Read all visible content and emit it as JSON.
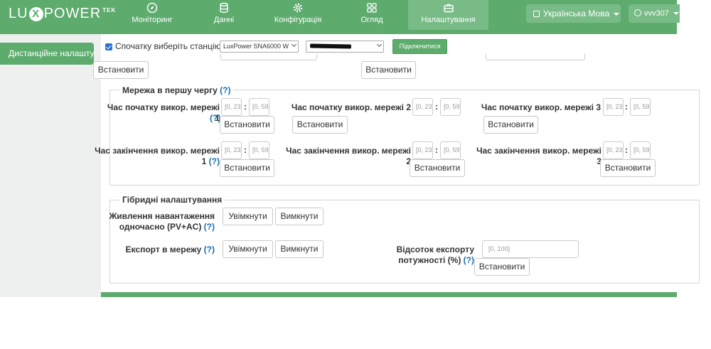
{
  "header": {
    "logo": {
      "pre": "LU",
      "x": "X",
      "post": "POWER",
      "tek": "TEK"
    },
    "nav": [
      {
        "label": "Моніторинг",
        "icon": "compass-icon"
      },
      {
        "label": "Данні",
        "icon": "database-icon"
      },
      {
        "label": "Конфігурація",
        "icon": "gear-icon"
      },
      {
        "label": "Огляд",
        "icon": "grid-icon"
      },
      {
        "label": "Налаштування",
        "icon": "briefcase-icon",
        "active": true
      }
    ],
    "language": "Українська Мова",
    "user": "vvv307"
  },
  "sidebar": {
    "active_item": "Дистанційне налаштування"
  },
  "station_bar": {
    "checkbox_label": "Спочатку виберіть станцію",
    "checked": true,
    "station_select": "LuxPower SNA6000 W",
    "connect_button": "Підключитися"
  },
  "top_buttons": {
    "set1": "Встановити",
    "set2": "Встановити"
  },
  "grid_first": {
    "legend": "Мережа в першу чергу",
    "help": "(?)",
    "set_label": "Встановити",
    "colon": ":",
    "start_hour_placeholder": "[0, 23]",
    "start_min_placeholder": "[0, 59]",
    "start": [
      {
        "label": "Час початку викор. мережі 1",
        "help": "(?)"
      },
      {
        "label": "Час початку викор. мережі 2",
        "help": "(?)"
      },
      {
        "label": "Час початку викор. мережі 3",
        "help": "(?)"
      }
    ],
    "end": [
      {
        "label_a": "Час закінчення викор. мережі",
        "label_b": "1",
        "help": "(?)"
      },
      {
        "label_a": "Час закінчення викор. мережі",
        "label_b": "2",
        "help": ""
      },
      {
        "label_a": "Час закінчення викор. мережі",
        "label_b": "3",
        "help": ""
      }
    ]
  },
  "hybrid": {
    "legend": "Гібридні налаштування",
    "load_supply": {
      "label_a": "Живлення навантаження",
      "label_b": "одночасно (PV+AC)",
      "help": "(?)",
      "on": "Увімкнути",
      "off": "Вимкнути"
    },
    "export": {
      "label": "Експорт в мережу",
      "help": "(?)",
      "on": "Увімкнути",
      "off": "Вимкнути"
    },
    "export_percent": {
      "label_a": "Відсоток експорту",
      "label_b": "потужності (%)",
      "help": "(?)",
      "placeholder": "[0, 100]",
      "set": "Встановити"
    }
  }
}
